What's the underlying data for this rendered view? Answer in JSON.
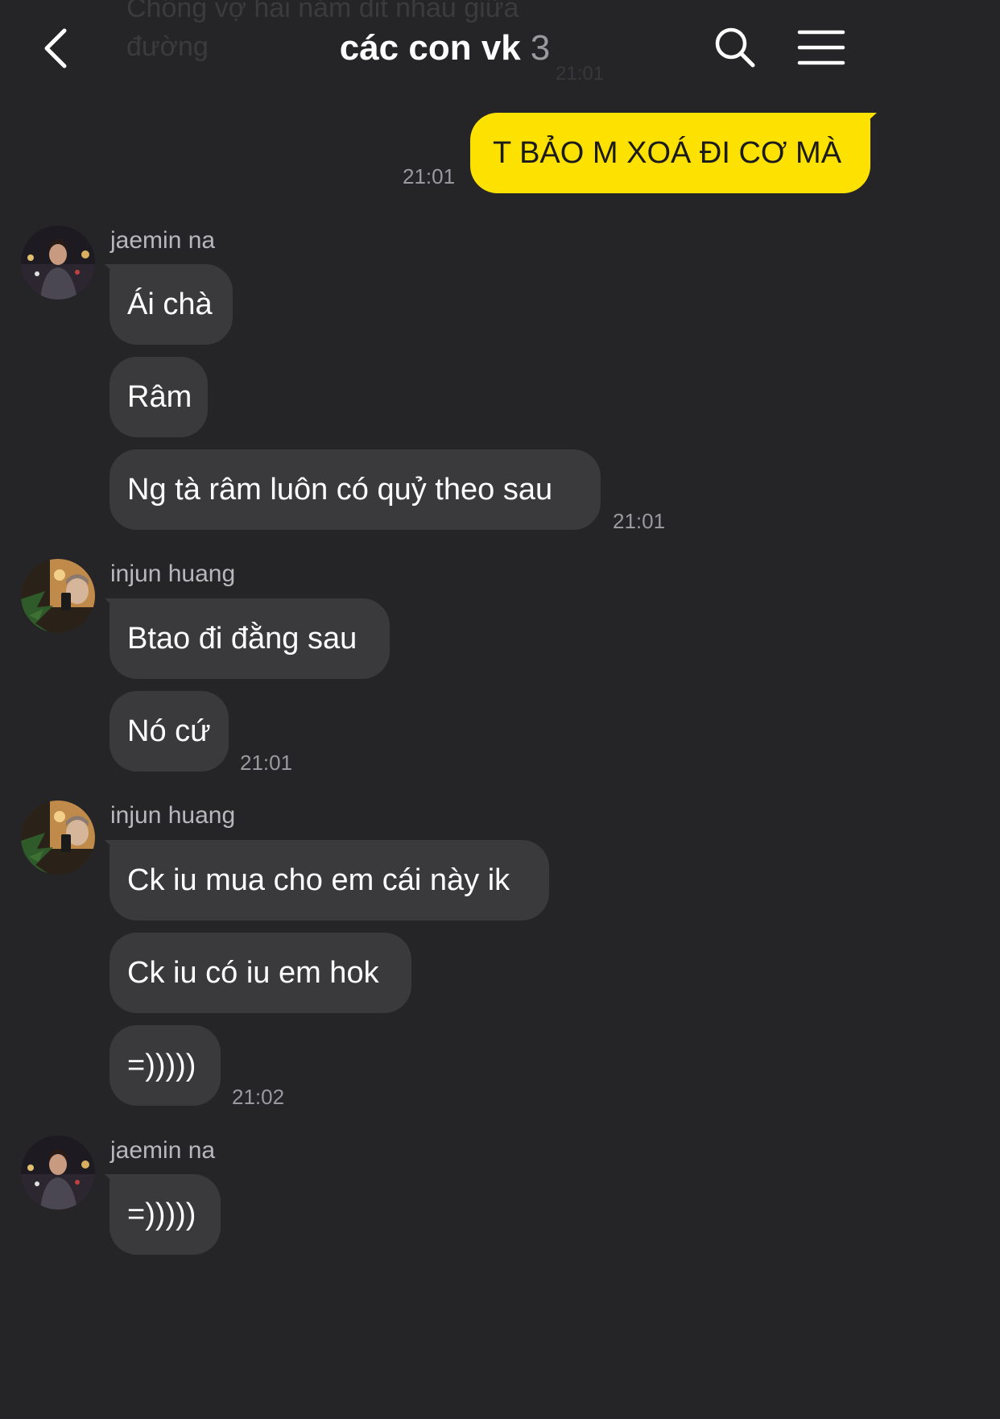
{
  "background_ghost": {
    "text": "Chồng vợ hai năm dit nhau giữa đường",
    "time": "21:01"
  },
  "header": {
    "title": "các con vk",
    "count": "3",
    "back_icon": "chevron-left-icon",
    "search_icon": "search-icon",
    "menu_icon": "hamburger-menu-icon"
  },
  "colors": {
    "background": "#252527",
    "incoming_bubble": "#3a3a3d",
    "outgoing_bubble": "#fde100",
    "timestamp": "#9a9a9e"
  },
  "messages": {
    "m0": {
      "text": "T BẢO M XOÁ ĐI CƠ MÀ",
      "time": "21:01"
    },
    "g1": {
      "sender": "jaemin na",
      "b1": "Ái chà",
      "b2": "Râm",
      "b3": "Ng tà râm luôn có quỷ theo sau",
      "time": "21:01"
    },
    "g2": {
      "sender": "injun huang",
      "b1": "Btao đi đằng sau",
      "b2": "Nó cứ",
      "time": "21:01"
    },
    "g3": {
      "sender": "injun huang",
      "b1": "Ck iu mua cho em cái này ik",
      "b2": "Ck iu có iu em hok",
      "b3": "=)))))",
      "time": "21:02"
    },
    "g4": {
      "sender": "jaemin na",
      "b1": "=)))))"
    }
  }
}
